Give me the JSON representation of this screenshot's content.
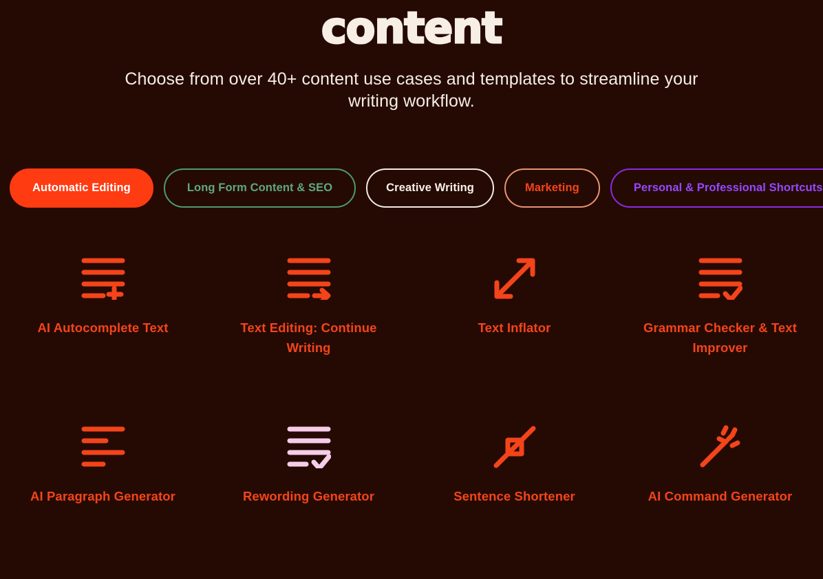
{
  "hero": {
    "title": "content",
    "subtitle": "Choose from over 40+ content use cases and templates to streamline your writing workflow."
  },
  "filters": {
    "items": [
      {
        "label": "Automatic Editing",
        "variant": "active",
        "color": "#FF3B12"
      },
      {
        "label": "Long Form Content & SEO",
        "variant": "green",
        "color": "#5FA97C"
      },
      {
        "label": "Creative Writing",
        "variant": "cream",
        "color": "#F7F1EA"
      },
      {
        "label": "Marketing",
        "variant": "salmon",
        "color": "#F4441A"
      },
      {
        "label": "Personal & Professional Shortcuts",
        "variant": "purple",
        "color": "#9747FF"
      }
    ]
  },
  "cards": {
    "items": [
      {
        "label": "AI Autocomplete Text",
        "icon": "lines-plus-icon",
        "icon_color": "#F4441A"
      },
      {
        "label": "Text Editing: Continue Writing",
        "icon": "lines-arrow-right-icon",
        "icon_color": "#F4441A"
      },
      {
        "label": "Text Inflator",
        "icon": "expand-diagonal-arrows-icon",
        "icon_color": "#F4441A"
      },
      {
        "label": "Grammar Checker & Text Improver",
        "icon": "lines-check-icon",
        "icon_color": "#F4441A"
      },
      {
        "label": "AI Paragraph Generator",
        "icon": "lines-alternating-icon",
        "icon_color": "#F4441A"
      },
      {
        "label": "Rewording Generator",
        "icon": "lines-check-icon",
        "icon_color": "#F6CDE9"
      },
      {
        "label": "Sentence Shortener",
        "icon": "collapse-diagonal-arrows-icon",
        "icon_color": "#F4441A"
      },
      {
        "label": "AI Command Generator",
        "icon": "magic-wand-icon",
        "icon_color": "#F4441A"
      }
    ]
  },
  "theme": {
    "background": "#250A04",
    "accent": "#FF3B12",
    "text_cream": "#F5EDE4"
  }
}
